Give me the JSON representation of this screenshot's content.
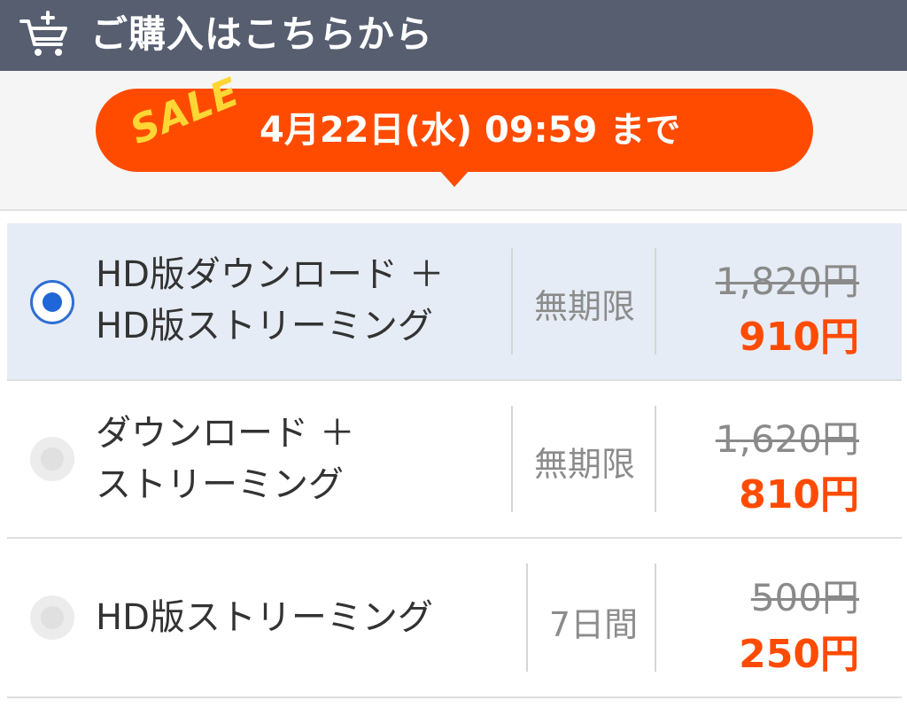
{
  "header": {
    "title": "ご購入はこちらから",
    "cart_icon": "cart-plus-icon"
  },
  "sale": {
    "badge": "SALE",
    "deadline": "4月22日(水) 09:59 まで",
    "color": "#ff4b00",
    "badge_color": "#ffd633"
  },
  "options": [
    {
      "name_line1": "HD版ダウンロード ＋",
      "name_line2": "HD版ストリーミング",
      "period": "無期限",
      "old_price": "1,820円",
      "new_price": "910円",
      "selected": true
    },
    {
      "name_line1": "ダウンロード ＋",
      "name_line2": "ストリーミング",
      "period": "無期限",
      "old_price": "1,620円",
      "new_price": "810円",
      "selected": false
    },
    {
      "name_line1": "HD版ストリーミング",
      "period": "7日間",
      "old_price": "500円",
      "new_price": "250円",
      "selected": false
    }
  ]
}
